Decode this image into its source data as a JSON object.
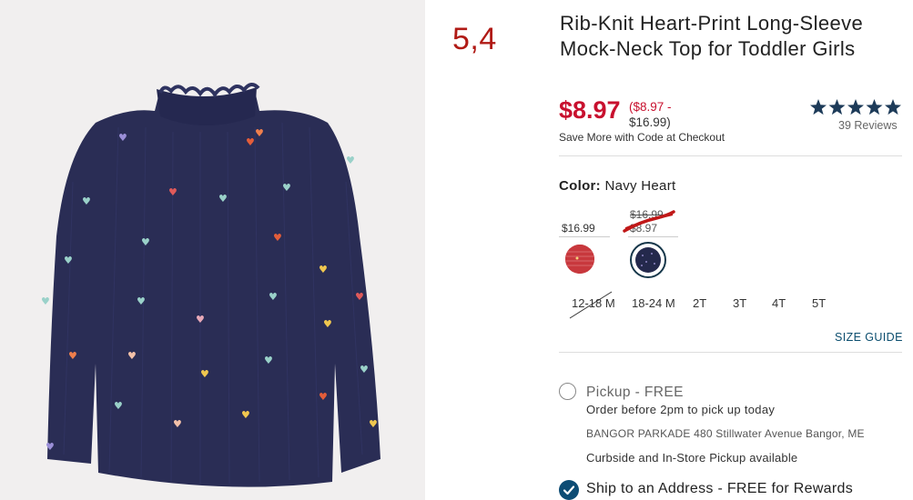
{
  "annotation": "5,4",
  "product": {
    "title": "Rib-Knit Heart-Print Long-Sleeve Mock-Neck Top for Toddler Girls",
    "price": "$8.97",
    "price_range_line1": "($8.97 -",
    "price_range_line2": "$16.99)",
    "promo": "Save More with Code at Checkout",
    "rating_stars": 5,
    "reviews": "39 Reviews"
  },
  "color": {
    "label": "Color:",
    "value": "Navy Heart",
    "swatches": [
      {
        "name": "Red stripe",
        "price": "$16.99",
        "hex": "#c8383d"
      },
      {
        "name": "Navy Heart",
        "original_price": "$16.99",
        "sale_price": "$8.97",
        "hex": "#24294c",
        "selected": true
      }
    ]
  },
  "sizes": [
    "12-18 M",
    "18-24 M",
    "2T",
    "3T",
    "4T",
    "5T"
  ],
  "size_guide": "SIZE GUIDE",
  "pickup": {
    "title": "Pickup - FREE",
    "order_note": "Order before 2pm to pick up today",
    "store": "BANGOR PARKADE 480 Stillwater Avenue  Bangor, ME",
    "curbside": "Curbside and In-Store Pickup available"
  },
  "ship": {
    "title": "Ship to an Address - FREE for Rewards"
  },
  "colors": {
    "sale_red": "#c8102e",
    "navy": "#24294c",
    "link_blue": "#0a4d6e",
    "annotation_red": "#b01a15"
  }
}
